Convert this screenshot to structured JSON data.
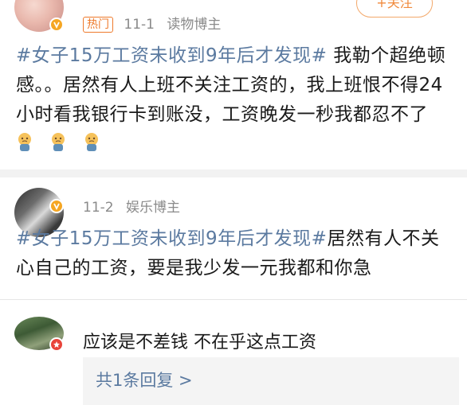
{
  "colors": {
    "topic": "#5b7aa0",
    "badge": "#ee7a2c",
    "divider": "#f2f2f2",
    "reply_bg": "#f4f4f4"
  },
  "posts": [
    {
      "badge": "热门",
      "date": "11-1",
      "role": "读物博主",
      "follow_label": "+关注",
      "topic": "#女子15万工资未收到9年后才发现#",
      "text": "我勒个超绝顿感。。居然有人上班不关注工资的，我上班恨不得24小时看我银行卡到账没，工资晚发一秒我都忍不了",
      "emoji": [
        "crying-emoji",
        "crying-emoji",
        "crying-emoji"
      ]
    },
    {
      "date": "11-2",
      "role": "娱乐博主",
      "topic": "#女子15万工资未收到9年后才发现#",
      "text": "居然有人不关心自己的工资，要是我少发一元我都和你急"
    }
  ],
  "comment": {
    "text": "应该是不差钱 不在乎这点工资",
    "reply_link": "共1条回复 >"
  }
}
